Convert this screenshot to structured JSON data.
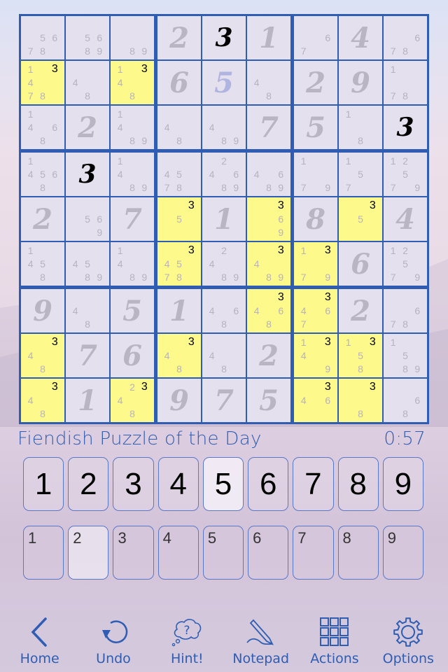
{
  "puzzle": {
    "title": "Fiendish Puzzle of the Day",
    "timer": "0:57",
    "grid": [
      [
        {
          "pm": [
            5,
            6,
            7,
            8
          ]
        },
        {
          "pm": [
            5,
            6,
            8,
            9
          ]
        },
        {
          "pm": [
            8,
            9
          ]
        },
        {
          "v": "2",
          "t": "given"
        },
        {
          "v": "3",
          "t": "user"
        },
        {
          "v": "1",
          "t": "given"
        },
        {
          "pm": [
            6,
            7
          ]
        },
        {
          "v": "4",
          "t": "given"
        },
        {
          "pm": [
            6,
            7,
            8
          ]
        }
      ],
      [
        {
          "pm": [
            1,
            3,
            4,
            7,
            8
          ],
          "hl": true
        },
        {
          "pm": [
            4,
            8
          ]
        },
        {
          "pm": [
            1,
            3,
            4,
            8
          ],
          "hl": true
        },
        {
          "v": "6",
          "t": "given"
        },
        {
          "v": "5",
          "t": "selected"
        },
        {
          "pm": [
            4,
            8
          ]
        },
        {
          "v": "2",
          "t": "given"
        },
        {
          "v": "9",
          "t": "given"
        },
        {
          "pm": [
            1,
            7,
            8
          ]
        }
      ],
      [
        {
          "pm": [
            1,
            4,
            6,
            8
          ]
        },
        {
          "v": "2",
          "t": "given"
        },
        {
          "pm": [
            1,
            4,
            8,
            9
          ]
        },
        {
          "pm": [
            4,
            8
          ]
        },
        {
          "pm": [
            4,
            8,
            9
          ]
        },
        {
          "v": "7",
          "t": "given"
        },
        {
          "v": "5",
          "t": "given"
        },
        {
          "pm": [
            1,
            8
          ]
        },
        {
          "v": "3",
          "t": "user"
        }
      ],
      [
        {
          "pm": [
            1,
            4,
            5,
            6,
            8
          ]
        },
        {
          "v": "3",
          "t": "user"
        },
        {
          "pm": [
            1,
            4,
            8,
            9
          ]
        },
        {
          "pm": [
            4,
            5,
            7,
            8
          ]
        },
        {
          "pm": [
            2,
            4,
            6,
            8,
            9
          ]
        },
        {
          "pm": [
            4,
            6,
            8,
            9
          ]
        },
        {
          "pm": [
            1,
            7,
            9
          ]
        },
        {
          "pm": [
            1,
            5,
            7
          ]
        },
        {
          "pm": [
            1,
            2,
            5,
            7,
            9
          ]
        }
      ],
      [
        {
          "v": "2",
          "t": "given"
        },
        {
          "pm": [
            5,
            6,
            9
          ]
        },
        {
          "v": "7",
          "t": "given"
        },
        {
          "pm": [
            3,
            5
          ],
          "hl": true
        },
        {
          "v": "1",
          "t": "given"
        },
        {
          "pm": [
            3,
            6,
            9
          ],
          "hl": true
        },
        {
          "v": "8",
          "t": "given"
        },
        {
          "pm": [
            3,
            5
          ],
          "hl": true
        },
        {
          "v": "4",
          "t": "given"
        }
      ],
      [
        {
          "pm": [
            1,
            4,
            5,
            8
          ]
        },
        {
          "pm": [
            4,
            5,
            8,
            9
          ]
        },
        {
          "pm": [
            1,
            4,
            8,
            9
          ]
        },
        {
          "pm": [
            3,
            4,
            5,
            7,
            8
          ],
          "hl": true
        },
        {
          "pm": [
            2,
            4,
            8,
            9
          ]
        },
        {
          "pm": [
            3,
            4,
            8,
            9
          ],
          "hl": true
        },
        {
          "pm": [
            1,
            3,
            7,
            9
          ],
          "hl": true
        },
        {
          "v": "6",
          "t": "given"
        },
        {
          "pm": [
            1,
            2,
            5,
            7,
            9
          ]
        }
      ],
      [
        {
          "v": "9",
          "t": "given"
        },
        {
          "pm": [
            4,
            8
          ]
        },
        {
          "v": "5",
          "t": "given"
        },
        {
          "v": "1",
          "t": "given"
        },
        {
          "pm": [
            4,
            6,
            8
          ]
        },
        {
          "pm": [
            3,
            4,
            6,
            8
          ],
          "hl": true
        },
        {
          "pm": [
            3,
            4,
            6,
            7
          ],
          "hl": true
        },
        {
          "v": "2",
          "t": "given"
        },
        {
          "pm": [
            6,
            7,
            8
          ]
        }
      ],
      [
        {
          "pm": [
            3,
            4,
            8
          ],
          "hl": true
        },
        {
          "v": "7",
          "t": "given"
        },
        {
          "v": "6",
          "t": "given"
        },
        {
          "pm": [
            3,
            4,
            8
          ],
          "hl": true
        },
        {
          "pm": [
            4,
            8
          ]
        },
        {
          "v": "2",
          "t": "given"
        },
        {
          "pm": [
            1,
            3,
            4,
            9
          ],
          "hl": true
        },
        {
          "pm": [
            1,
            3,
            5,
            8
          ],
          "hl": true
        },
        {
          "pm": [
            1,
            5,
            8,
            9
          ]
        }
      ],
      [
        {
          "pm": [
            3,
            4,
            8
          ],
          "hl": true
        },
        {
          "v": "1",
          "t": "given"
        },
        {
          "pm": [
            2,
            3,
            4,
            8
          ],
          "hl": true
        },
        {
          "v": "9",
          "t": "given"
        },
        {
          "v": "7",
          "t": "given"
        },
        {
          "v": "5",
          "t": "given"
        },
        {
          "pm": [
            3,
            4,
            6
          ],
          "hl": true
        },
        {
          "pm": [
            3,
            8
          ],
          "hl": true
        },
        {
          "pm": [
            6,
            8
          ]
        }
      ]
    ],
    "highlighted_digit": 3
  },
  "numpad": {
    "keys": [
      "1",
      "2",
      "3",
      "4",
      "5",
      "6",
      "7",
      "8",
      "9"
    ],
    "active": "5"
  },
  "notepad_keys": {
    "keys": [
      "1",
      "2",
      "3",
      "4",
      "5",
      "6",
      "7",
      "8",
      "9"
    ],
    "active": "2"
  },
  "toolbar": {
    "items": [
      {
        "label": "Home",
        "icon": "chevron-left-icon"
      },
      {
        "label": "Undo",
        "icon": "undo-icon"
      },
      {
        "label": "Hint!",
        "icon": "thought-bubble-question-icon"
      },
      {
        "label": "Notepad",
        "icon": "pencil-icon"
      },
      {
        "label": "Actions",
        "icon": "grid-icon"
      },
      {
        "label": "Options",
        "icon": "gear-icon"
      }
    ]
  },
  "colors": {
    "accent": "#2f5db3",
    "highlight": "#fdf98a"
  }
}
